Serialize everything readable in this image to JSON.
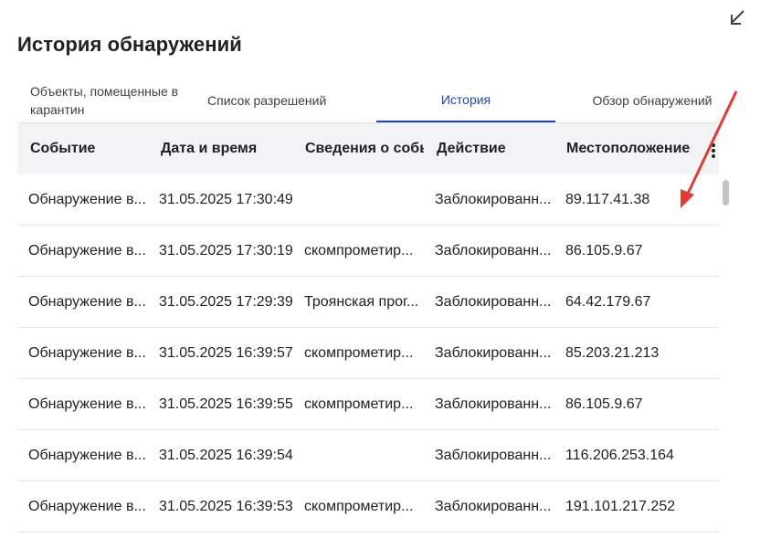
{
  "dialog": {
    "title": "История обнаружений"
  },
  "tabs": [
    {
      "label": "Объекты, помещенные в карантин",
      "active": false
    },
    {
      "label": "Список разрешений",
      "active": false
    },
    {
      "label": "История",
      "active": true
    },
    {
      "label": "Обзор обнаружений",
      "active": false
    }
  ],
  "table": {
    "columns": [
      "Событие",
      "Дата и время",
      "Сведения о собы",
      "Действие",
      "Местоположение"
    ],
    "rows": [
      {
        "event": "Обнаружение в...",
        "datetime": "31.05.2025 17:30:49",
        "info": "",
        "action": "Заблокированн...",
        "location": "89.117.41.38"
      },
      {
        "event": "Обнаружение в...",
        "datetime": "31.05.2025 17:30:19",
        "info": "скомпрометир...",
        "action": "Заблокированн...",
        "location": "86.105.9.67"
      },
      {
        "event": "Обнаружение в...",
        "datetime": "31.05.2025 17:29:39",
        "info": "Троянская прог...",
        "action": "Заблокированн...",
        "location": "64.42.179.67"
      },
      {
        "event": "Обнаружение в...",
        "datetime": "31.05.2025 16:39:57",
        "info": "скомпрометир...",
        "action": "Заблокированн...",
        "location": "85.203.21.213"
      },
      {
        "event": "Обнаружение в...",
        "datetime": "31.05.2025 16:39:55",
        "info": "скомпрометир...",
        "action": "Заблокированн...",
        "location": "86.105.9.67"
      },
      {
        "event": "Обнаружение в...",
        "datetime": "31.05.2025 16:39:54",
        "info": "",
        "action": "Заблокированн...",
        "location": "116.206.253.164"
      },
      {
        "event": "Обнаружение в...",
        "datetime": "31.05.2025 16:39:53",
        "info": "скомпрометир...",
        "action": "Заблокированн...",
        "location": "191.101.217.252"
      }
    ]
  },
  "icons": {
    "collapse": "collapse-arrow-icon",
    "menu": "kebab-menu-icon"
  },
  "colors": {
    "accent": "#1a47b8",
    "header_bg": "#f1f3f4",
    "annotation_arrow": "#e53935"
  }
}
